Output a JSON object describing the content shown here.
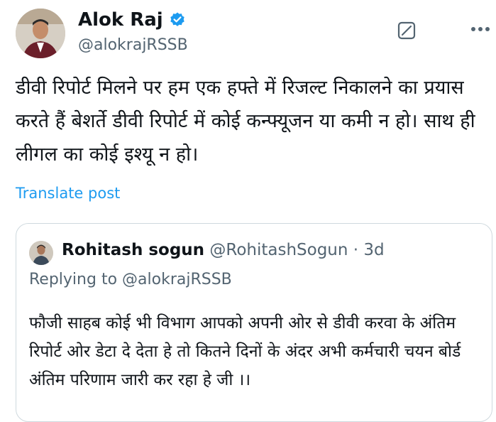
{
  "author": {
    "name": "Alok Raj",
    "handle": "@alokrajRSSB"
  },
  "tweet": {
    "text": "डीवी रिपोर्ट मिलने पर हम एक हफ्ते में रिजल्ट निकालने का प्रयास करते हैं बेशर्ते डीवी रिपोर्ट में कोई कन्फ्यूजन या कमी न हो। साथ ही लीगल का कोई इश्यू न हो।",
    "translate_label": "Translate post"
  },
  "quoted": {
    "name": "Rohitash sogun",
    "handle": "@RohitashSogun",
    "separator": "·",
    "time": "3d",
    "replying_prefix": "Replying to",
    "replying_handle": "@alokrajRSSB",
    "text": "फौजी साहब कोई भी विभाग आपको अपनी ओर से डीवी करवा के अंतिम रिपोर्ट ओर डेटा दे देता हे तो कितने दिनों के अंदर अभी कर्मचारी चयन बोर्ड अंतिम परिणाम जारी कर रहा हे जी ।।"
  },
  "icons": {
    "verified": "verified-badge-icon",
    "grok": "grok-icon",
    "more": "more-options-icon"
  },
  "colors": {
    "accent": "#1d9bf0",
    "muted": "#536471",
    "text": "#0f1419",
    "border": "#cfd9de"
  }
}
